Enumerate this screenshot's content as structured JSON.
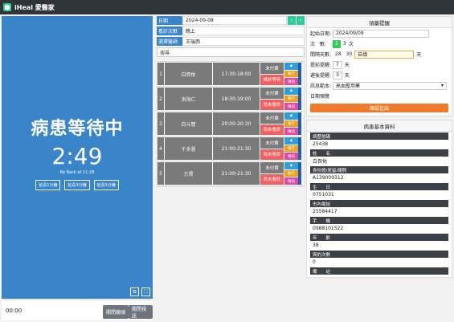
{
  "app": {
    "brand": "iHeal 愛醫家"
  },
  "waiting": {
    "message": "病患等待中",
    "timer": "2:49",
    "back_at": "Be Back at 11:28",
    "extend_buttons": [
      "延長1分鐘",
      "延長3分鐘",
      "延長5分鐘"
    ],
    "corner_icons": [
      "⧉",
      "⛶"
    ]
  },
  "bottom": {
    "elapsed": "00:00",
    "close_video_label": "關閉鏡頭",
    "close_window_label": "關閉視訊"
  },
  "header_info": {
    "date_label": "日期",
    "date_value": "2024-09-08",
    "prev_arrow": "‹",
    "next_arrow": "›",
    "session_label": "看診次數",
    "session_value": "晚上",
    "doctor_label": "選擇醫師",
    "doctor_value": "王瑞西",
    "search_placeholder": "搜尋"
  },
  "patients": [
    {
      "no": "1",
      "name": "白賀佑",
      "time": "17:30-18:00",
      "pay": "未付費",
      "visit": "候診等待",
      "tag": "◆",
      "exec": "執行",
      "msg": "傳訊"
    },
    {
      "no": "2",
      "name": "洪海仁",
      "time": "18:30-19:00",
      "pay": "未付費",
      "visit": "尚未看診",
      "tag": "◆",
      "exec": "執行",
      "msg": "傳訊"
    },
    {
      "no": "3",
      "name": "白斗閒",
      "time": "20:00-20:30",
      "pay": "未付費",
      "visit": "尚未看診",
      "tag": "◆",
      "exec": "執行",
      "msg": "傳訊"
    },
    {
      "no": "4",
      "name": "千多慧",
      "time": "21:00-21:30",
      "pay": "未付費",
      "visit": "尚未看診",
      "tag": "◆",
      "exec": "執行",
      "msg": "傳訊"
    },
    {
      "no": "5",
      "name": "方賢",
      "time": "21:00-21:30",
      "pay": "未付費",
      "visit": "尚未看診",
      "tag": "◆",
      "exec": "執行",
      "msg": "傳訊"
    }
  ],
  "reminder": {
    "title": "領藥提醒",
    "start_label": "起始日期:",
    "start_value": "2024/09/09",
    "count_label": "次　數:",
    "count_selected": "2",
    "count_other": "3",
    "count_unit": "次",
    "interval_label": "間隔天數:",
    "interval_a": "28",
    "interval_b": "30",
    "interval_custom": "自填",
    "interval_unit": "天",
    "advance_label": "提前提醒:",
    "advance_value": "7",
    "advance_unit": "天",
    "delay_label": "遲後提醒:",
    "delay_value": "3",
    "delay_unit": "天",
    "template_label": "訊息範本:",
    "template_value": "高血壓用藥",
    "preview_label": "日期預覽",
    "submit_label": "確認送出"
  },
  "basic_info": {
    "title": "病患基本資料",
    "fields": [
      {
        "label": "病歷號碼",
        "value": "25438"
      },
      {
        "label": "姓　　名",
        "value": "白賀佑"
      },
      {
        "label": "身份證/居留/護照",
        "value": "A139009312"
      },
      {
        "label": "生　　日",
        "value": "0751031"
      },
      {
        "label": "市內電話",
        "value": "25584417"
      },
      {
        "label": "手　　機",
        "value": "0988101522"
      },
      {
        "label": "年　　齡",
        "value": "38"
      },
      {
        "label": "爽約次數",
        "value": "0"
      },
      {
        "label": "備　　註",
        "value": ""
      }
    ]
  }
}
